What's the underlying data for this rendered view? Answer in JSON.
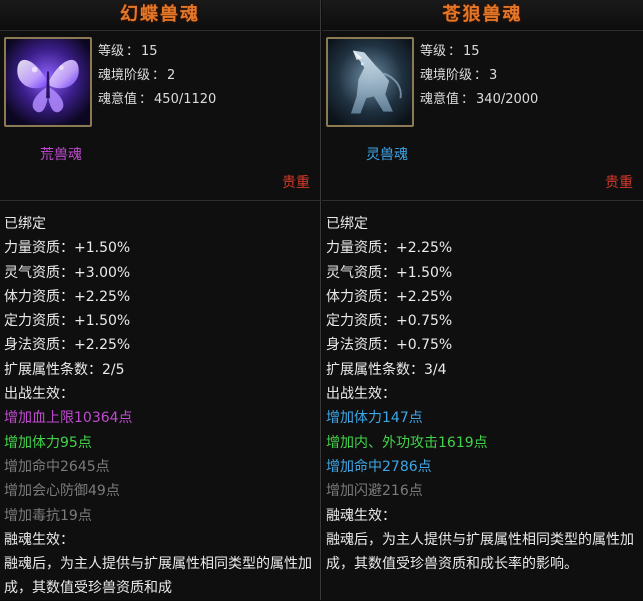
{
  "left": {
    "name": "幻蝶兽魂",
    "icon": "butterfly-icon",
    "level_label": "等级",
    "level_value": "15",
    "realm_label": "魂境阶级",
    "realm_value": "2",
    "soul_label": "魂意值",
    "soul_value": "450/1120",
    "soul_type": "荒兽魂",
    "rarity": "贵重",
    "lines": [
      {
        "text": "已绑定",
        "color": "white"
      },
      {
        "text": "力量资质：+1.50%",
        "color": "white"
      },
      {
        "text": "灵气资质：+3.00%",
        "color": "white"
      },
      {
        "text": "体力资质：+2.25%",
        "color": "white"
      },
      {
        "text": "定力资质：+1.50%",
        "color": "white"
      },
      {
        "text": "身法资质：+2.25%",
        "color": "white"
      },
      {
        "text": "扩展属性条数：2/5",
        "color": "white"
      },
      {
        "text": "出战生效：",
        "color": "white"
      },
      {
        "text": "增加血上限10364点",
        "color": "purple"
      },
      {
        "text": "增加体力95点",
        "color": "green"
      },
      {
        "text": "增加命中2645点",
        "color": "gray"
      },
      {
        "text": "增加会心防御49点",
        "color": "gray"
      },
      {
        "text": "增加毒抗19点",
        "color": "gray"
      },
      {
        "text": "融魂生效：",
        "color": "white"
      },
      {
        "text": "融魂后，为主人提供与扩展属性相同类型的属性加成，其数值受珍兽资质和成",
        "color": "white"
      }
    ]
  },
  "right": {
    "name": "苍狼兽魂",
    "icon": "wolf-icon",
    "level_label": "等级",
    "level_value": "15",
    "realm_label": "魂境阶级",
    "realm_value": "3",
    "soul_label": "魂意值",
    "soul_value": "340/2000",
    "soul_type": "灵兽魂",
    "rarity": "贵重",
    "lines": [
      {
        "text": "已绑定",
        "color": "white"
      },
      {
        "text": "力量资质：+2.25%",
        "color": "white"
      },
      {
        "text": "灵气资质：+1.50%",
        "color": "white"
      },
      {
        "text": "体力资质：+2.25%",
        "color": "white"
      },
      {
        "text": "定力资质：+0.75%",
        "color": "white"
      },
      {
        "text": "身法资质：+0.75%",
        "color": "white"
      },
      {
        "text": "扩展属性条数：3/4",
        "color": "white"
      },
      {
        "text": "出战生效：",
        "color": "white"
      },
      {
        "text": "增加体力147点",
        "color": "blue"
      },
      {
        "text": "增加内、外功攻击1619点",
        "color": "green"
      },
      {
        "text": "增加命中2786点",
        "color": "blue"
      },
      {
        "text": "增加闪避216点",
        "color": "gray"
      },
      {
        "text": "融魂生效：",
        "color": "white"
      },
      {
        "text": "融魂后，为主人提供与扩展属性相同类型的属性加成，其数值受珍兽资质和成长率的影响。",
        "color": "white"
      }
    ]
  },
  "colors": {
    "title": "#e2772a",
    "purple": "#c04ad0",
    "green": "#43d34b",
    "blue": "#3fa6e6",
    "gray": "#7b7b7b",
    "rarity": "#d63a2a"
  }
}
